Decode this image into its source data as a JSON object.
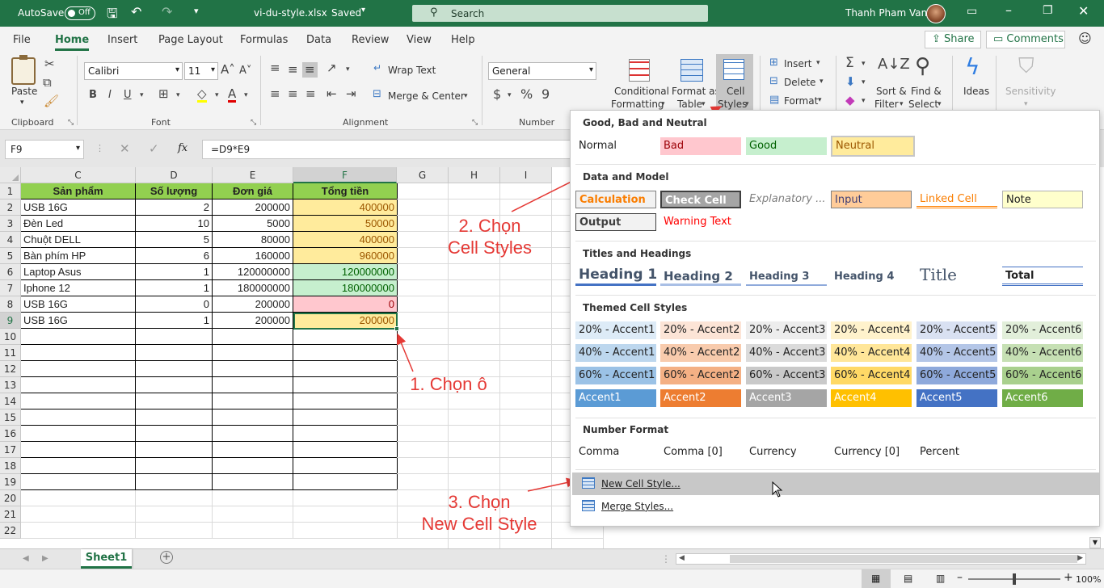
{
  "title_bar": {
    "autosave_label": "AutoSave",
    "autosave_state": "Off",
    "filename": "vi-du-style.xlsx",
    "saved_status": "Saved",
    "search_placeholder": "Search",
    "user_name": "Thanh Pham Van"
  },
  "menu_tabs": [
    "File",
    "Home",
    "Insert",
    "Page Layout",
    "Formulas",
    "Data",
    "Review",
    "View",
    "Help"
  ],
  "share_label": "Share",
  "comments_label": "Comments",
  "ribbon": {
    "clipboard": {
      "paste": "Paste",
      "label": "Clipboard"
    },
    "font": {
      "name": "Calibri",
      "size": "11",
      "label": "Font"
    },
    "alignment": {
      "wrap_text": "Wrap Text",
      "merge_center": "Merge & Center",
      "label": "Alignment"
    },
    "number": {
      "format": "General",
      "label": "Number"
    },
    "styles": {
      "conditional_1": "Conditional",
      "conditional_2": "Formatting",
      "format_table_1": "Format as",
      "format_table_2": "Table",
      "cell_styles_1": "Cell",
      "cell_styles_2": "Styles"
    },
    "cells": {
      "insert": "Insert",
      "delete": "Delete",
      "format": "Format"
    },
    "editing": {
      "sort_1": "Sort &",
      "sort_2": "Filter",
      "find_1": "Find &",
      "find_2": "Select"
    },
    "ideas": "Ideas",
    "sensitivity": "Sensitivity"
  },
  "formula_bar": {
    "name_box": "F9",
    "fx": "fx",
    "formula": "=D9*E9"
  },
  "columns": [
    "C",
    "D",
    "E",
    "F",
    "G",
    "H",
    "I"
  ],
  "rows": [
    "1",
    "2",
    "3",
    "4",
    "5",
    "6",
    "7",
    "8",
    "9",
    "10",
    "11",
    "12",
    "13",
    "14",
    "15",
    "16",
    "17",
    "18",
    "19",
    "20",
    "21",
    "22"
  ],
  "table": {
    "headers": [
      "Sản phẩm",
      "Số lượng",
      "Đơn giá",
      "Tổng tiền"
    ],
    "rows": [
      [
        "USB 16G",
        "2",
        "200000",
        "400000"
      ],
      [
        "Đèn Led",
        "10",
        "5000",
        "50000"
      ],
      [
        "Chuột DELL",
        "5",
        "80000",
        "400000"
      ],
      [
        "Bàn phím HP",
        "6",
        "160000",
        "960000"
      ],
      [
        "Laptop Asus",
        "1",
        "120000000",
        "120000000"
      ],
      [
        "Iphone 12",
        "1",
        "180000000",
        "180000000"
      ],
      [
        "USB 16G",
        "0",
        "200000",
        "0"
      ],
      [
        "USB 16G",
        "1",
        "200000",
        "200000"
      ]
    ],
    "total_styles": [
      "neutral",
      "neutral",
      "neutral",
      "neutral",
      "good",
      "good",
      "bad",
      "neutral"
    ]
  },
  "annotations": {
    "step1": "1. Chọn ô",
    "step2_line1": "2. Chọn",
    "step2_line2": "Cell Styles",
    "step3_line1": "3. Chọn",
    "step3_line2": "New Cell Style"
  },
  "styles_panel": {
    "sections": {
      "good_bad": "Good, Bad and Neutral",
      "data_model": "Data and Model",
      "titles": "Titles and Headings",
      "themed": "Themed Cell Styles",
      "number_format": "Number Format"
    },
    "good_bad": [
      "Normal",
      "Bad",
      "Good",
      "Neutral"
    ],
    "data_model": [
      "Calculation",
      "Check Cell",
      "Explanatory ...",
      "Input",
      "Linked Cell",
      "Note",
      "Output",
      "Warning Text"
    ],
    "titles": [
      "Heading 1",
      "Heading 2",
      "Heading 3",
      "Heading 4",
      "Title",
      "Total"
    ],
    "themed_rows": [
      [
        "20% - Accent1",
        "20% - Accent2",
        "20% - Accent3",
        "20% - Accent4",
        "20% - Accent5",
        "20% - Accent6"
      ],
      [
        "40% - Accent1",
        "40% - Accent2",
        "40% - Accent3",
        "40% - Accent4",
        "40% - Accent5",
        "40% - Accent6"
      ],
      [
        "60% - Accent1",
        "60% - Accent2",
        "60% - Accent3",
        "60% - Accent4",
        "60% - Accent5",
        "60% - Accent6"
      ],
      [
        "Accent1",
        "Accent2",
        "Accent3",
        "Accent4",
        "Accent5",
        "Accent6"
      ]
    ],
    "number_format": [
      "Comma",
      "Comma [0]",
      "Currency",
      "Currency [0]",
      "Percent"
    ],
    "menu": [
      "New Cell Style...",
      "Merge Styles..."
    ]
  },
  "sheet_tab": "Sheet1",
  "zoom": "100%",
  "colors": {
    "excel_green": "#217346",
    "header_fill": "#92d050",
    "neutral_fill": "#ffeb9c",
    "good_fill": "#c6efce",
    "bad_fill": "#ffc7ce",
    "annotation_red": "#e53935"
  }
}
